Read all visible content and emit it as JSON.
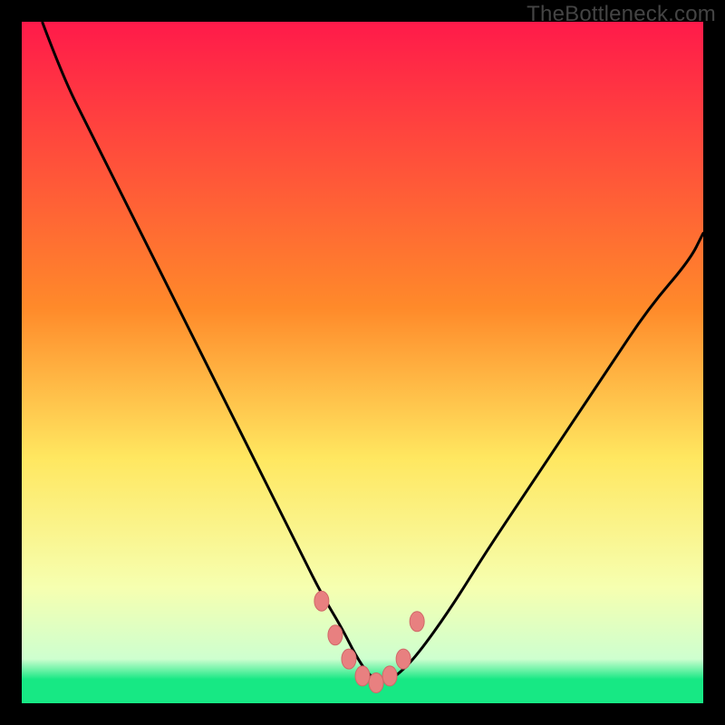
{
  "watermark": "TheBottleneck.com",
  "colors": {
    "frame": "#000000",
    "curve": "#000000",
    "marker_fill": "#e88080",
    "marker_stroke": "#d06868",
    "green": "#17e884",
    "yellow": "#ffe760",
    "orange": "#ff8a2a",
    "red": "#ff1440",
    "pink": "#ff2b5a"
  },
  "chart_data": {
    "type": "line",
    "title": "",
    "xlabel": "",
    "ylabel": "",
    "xlim": [
      0,
      100
    ],
    "ylim": [
      0,
      100
    ],
    "grid": false,
    "legend": false,
    "series": [
      {
        "name": "bottleneck-curve",
        "x": [
          3,
          6,
          10,
          14,
          18,
          22,
          26,
          30,
          34,
          38,
          41,
          44,
          47,
          49,
          51,
          53,
          55,
          58,
          63,
          68,
          74,
          80,
          86,
          92,
          98,
          100
        ],
        "y": [
          100,
          92,
          84,
          76,
          68,
          60,
          52,
          44,
          36,
          28,
          22,
          16,
          11,
          7,
          4,
          3,
          4,
          7,
          14,
          22,
          31,
          40,
          49,
          58,
          65,
          69
        ]
      }
    ],
    "markers": {
      "name": "highlight-points",
      "x": [
        44,
        46,
        48,
        50,
        52,
        54,
        56,
        58
      ],
      "y": [
        15,
        10,
        6.5,
        4,
        3,
        4,
        6.5,
        12
      ]
    },
    "gradient_stops": [
      {
        "pos": 0.0,
        "color": "#ff1a4a"
      },
      {
        "pos": 0.42,
        "color": "#ff8a2a"
      },
      {
        "pos": 0.64,
        "color": "#ffe760"
      },
      {
        "pos": 0.83,
        "color": "#f6ffb0"
      },
      {
        "pos": 0.935,
        "color": "#ceffcf"
      },
      {
        "pos": 0.965,
        "color": "#17e884"
      },
      {
        "pos": 1.0,
        "color": "#17e884"
      }
    ]
  }
}
